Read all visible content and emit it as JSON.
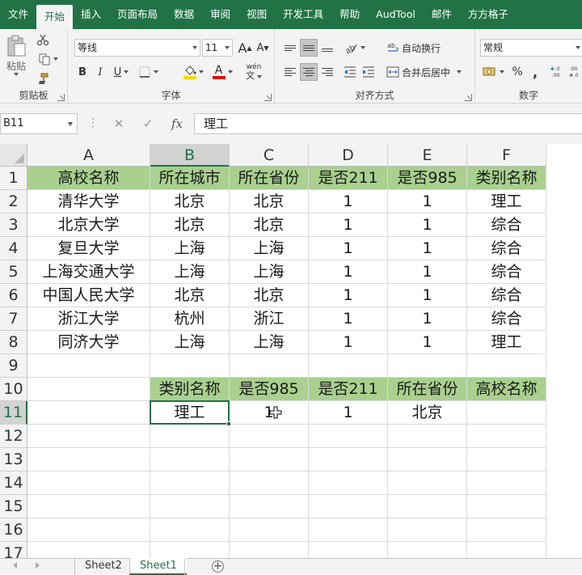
{
  "menu": {
    "tabs": [
      "文件",
      "开始",
      "插入",
      "页面布局",
      "数据",
      "审阅",
      "视图",
      "开发工具",
      "帮助",
      "AudTool",
      "邮件",
      "方方格子"
    ],
    "active_index": 1
  },
  "ribbon": {
    "clipboard": {
      "label": "剪贴板",
      "paste": "粘贴"
    },
    "font": {
      "label": "字体",
      "name": "等线",
      "size": "11",
      "grow": "A",
      "shrink": "A",
      "bold": "B",
      "italic": "I",
      "underline": "U",
      "font_color_letter": "A",
      "phonetic": "wén"
    },
    "alignment": {
      "label": "对齐方式",
      "wrap": "自动换行",
      "merge": "合并后居中"
    },
    "number": {
      "label": "数字",
      "format": "常规",
      "percent": "%",
      "comma": ",",
      "inc_decimal": ".0\n.00",
      "dec_decimal": ".00\n.0"
    },
    "colors": {
      "fill": "#ffd700",
      "font": "#e00000",
      "accent": "#217346",
      "header_fill": "#a9d08e"
    }
  },
  "formula_bar": {
    "name_box": "B11",
    "cancel": "✕",
    "enter": "✓",
    "fx": "fx",
    "content": "理工"
  },
  "grid": {
    "columns": [
      "A",
      "B",
      "C",
      "D",
      "E",
      "F"
    ],
    "rows": [
      "1",
      "2",
      "3",
      "4",
      "5",
      "6",
      "7",
      "8",
      "9",
      "10",
      "11",
      "12",
      "13",
      "14",
      "15",
      "16",
      "17"
    ],
    "selected_col": "B",
    "selected_row": "11",
    "cells": {
      "r1": [
        "高校名称",
        "所在城市",
        "所在省份",
        "是否211",
        "是否985",
        "类别名称"
      ],
      "r2": [
        "清华大学",
        "北京",
        "北京",
        "1",
        "1",
        "理工"
      ],
      "r3": [
        "北京大学",
        "北京",
        "北京",
        "1",
        "1",
        "综合"
      ],
      "r4": [
        "复旦大学",
        "上海",
        "上海",
        "1",
        "1",
        "综合"
      ],
      "r5": [
        "上海交通大学",
        "上海",
        "上海",
        "1",
        "1",
        "综合"
      ],
      "r6": [
        "中国人民大学",
        "北京",
        "北京",
        "1",
        "1",
        "综合"
      ],
      "r7": [
        "浙江大学",
        "杭州",
        "浙江",
        "1",
        "1",
        "综合"
      ],
      "r8": [
        "同济大学",
        "上海",
        "上海",
        "1",
        "1",
        "理工"
      ],
      "r10": [
        "",
        "类别名称",
        "是否985",
        "是否211",
        "所在省份",
        "高校名称"
      ],
      "r11": [
        "",
        "理工",
        "1",
        "1",
        "北京",
        ""
      ]
    }
  },
  "sheets": {
    "tabs": [
      "Sheet2",
      "Sheet1"
    ],
    "active": "Sheet1",
    "add": "+"
  }
}
